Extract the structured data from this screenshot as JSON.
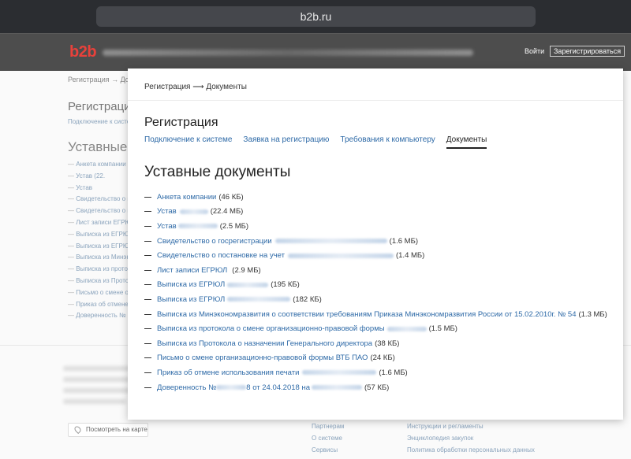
{
  "browser": {
    "url": "b2b.ru"
  },
  "header": {
    "logo": "b2b",
    "login_label": "Войти",
    "register_label": "Зарегистрироваться",
    "accent_color": "#e8413b"
  },
  "background": {
    "breadcrumb": "Регистрация → Доку",
    "title": "Регистрация",
    "subtitle": "Подключение к систе",
    "heading": "Уставные д",
    "items": [
      "Анкета компании (4",
      "Устав (22.",
      "Устав",
      "Свидетельство о г",
      "Свидетельство о п",
      "Лист записи ЕГРЮЛ",
      "Выписка из ЕГРЮЛ",
      "Выписка из ЕГРЮЛ",
      "Выписка из Минэко",
      "Выписка из протоко",
      "Выписка из Протоко",
      "Письмо о смене орг",
      "Приказ об отмене",
      "Доверенность №"
    ],
    "map_button": "Посмотреть на карте",
    "footer_col1": [
      "Партнерам",
      "О системе",
      "Сервисы"
    ],
    "footer_col2": [
      "Инструкции и регламенты",
      "Энциклопедия закупок",
      "Политика обработки персональных данных"
    ]
  },
  "modal": {
    "breadcrumb": "Регистрация ⟶ Документы",
    "title": "Регистрация",
    "tabs": [
      {
        "label": "Подключение к системе",
        "active": false
      },
      {
        "label": "Заявка на регистрацию",
        "active": false
      },
      {
        "label": "Требования к компьютеру",
        "active": false
      },
      {
        "label": "Документы",
        "active": true
      }
    ],
    "heading": "Уставные документы",
    "documents": [
      {
        "name": "Анкета компании",
        "size": "(46 КБ)"
      },
      {
        "name": "Устав",
        "size": "(22.4 МБ)"
      },
      {
        "name": "Устав",
        "size": "(2.5 МБ)"
      },
      {
        "name": "Свидетельство о госрегистрации",
        "size": "(1.6 МБ)"
      },
      {
        "name": "Свидетельство о постановке на учет",
        "size": "(1.4 МБ)"
      },
      {
        "name": "Лист записи ЕГРЮЛ",
        "size": "(2.9 МБ)"
      },
      {
        "name": "Выписка из ЕГРЮЛ",
        "size": "(195 КБ)"
      },
      {
        "name": "Выписка из ЕГРЮЛ",
        "size": "(182 КБ)"
      },
      {
        "name": "Выписка из Минэкономразвития о соответствии требованиям Приказа Минэкономразвития России от 15.02.2010г. № 54",
        "size": "(1.3 МБ)"
      },
      {
        "name": "Выписка из протокола о смене организационно-правовой формы",
        "size": "(1.5 МБ)"
      },
      {
        "name": "Выписка из Протокола о назначении Генерального директора",
        "size": "(38 КБ)"
      },
      {
        "name": "Письмо о смене организационно-правовой формы ВТБ ПАО",
        "size": "(24 КБ)"
      },
      {
        "name": "Приказ об отмене использования печати",
        "size": "(1.6 МБ)"
      },
      {
        "name": "Доверенность №",
        "name_tail": "8 от 24.04.2018 на",
        "size": "(57 КБ)"
      }
    ]
  }
}
